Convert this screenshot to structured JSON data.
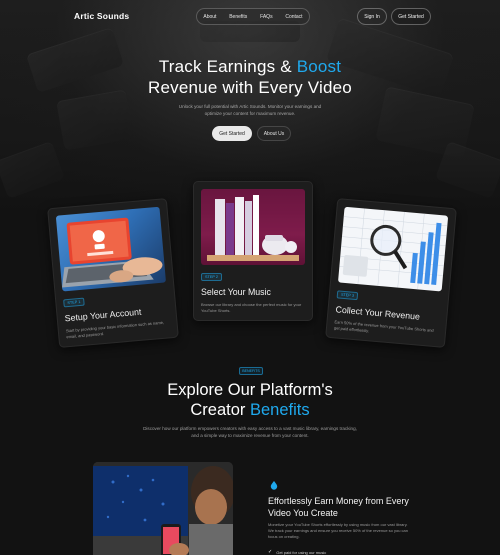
{
  "brand": {
    "name": "Artic Sounds",
    "accent": "#1fa9ee"
  },
  "nav": {
    "links": [
      "About",
      "Benefits",
      "FAQs",
      "Contact"
    ],
    "signin_label": "Sign In",
    "get_started_label": "Get Started"
  },
  "hero": {
    "title_part1": "Track Earnings & ",
    "title_accent": "Boost",
    "title_line2": "Revenue with Every Video",
    "subtitle": "Unlock your full potential with Artic Sounds. Monitor your earnings and optimize your content for maximum revenue.",
    "primary_button": "Get Started",
    "secondary_button": "About Us"
  },
  "steps": [
    {
      "badge": "STEP 1",
      "title": "Setup Your Account",
      "description": "Start by providing your basic information such as name, email, and password."
    },
    {
      "badge": "STEP 2",
      "title": "Select Your Music",
      "description": "Browse our library and choose the perfect music for your YouTube Shorts."
    },
    {
      "badge": "STEP 3",
      "title": "Collect Your Revenue",
      "description": "Earn 50% of the revenue from your YouTube Shorts and get paid effortlessly."
    }
  ],
  "benefits": {
    "badge": "BENEFITS",
    "title_line1": "Explore Our Platform's",
    "title_line2_plain": "Creator ",
    "title_line2_accent": "Benefits",
    "subtitle": "Discover how our platform empowers creators with easy access to a vast music library, earnings tracking, and a simple way to maximize revenue from your content.",
    "feature": {
      "title": "Effortlessly Earn Money from Every Video You Create",
      "description": "Monetize your YouTube Shorts effortlessly by using music from our vast library. We track your earnings and ensure you receive 50% of the revenue so you can focus on creating.",
      "bullet": "Get paid for using our music"
    }
  }
}
